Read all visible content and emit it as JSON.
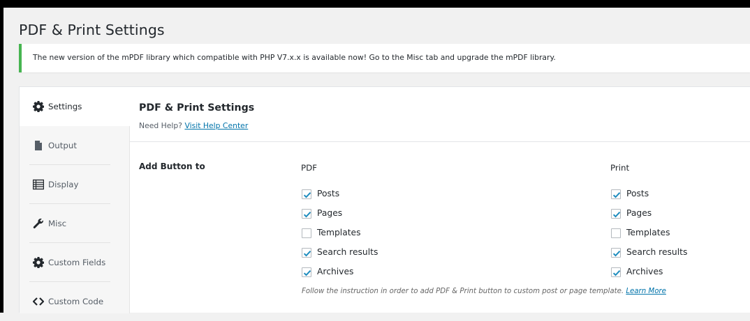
{
  "page": {
    "title": "PDF & Print Settings"
  },
  "notice": {
    "text": "The new version of the mPDF library which compatible with PHP V7.x.x is available now! Go to the Misc tab and upgrade the mPDF library.",
    "accent": "#46b450"
  },
  "sidebar": {
    "tabs": [
      {
        "label": "Settings",
        "icon": "gear-icon",
        "active": true
      },
      {
        "label": "Output",
        "icon": "document-icon",
        "active": false
      },
      {
        "label": "Display",
        "icon": "list-icon",
        "active": false
      },
      {
        "label": "Misc",
        "icon": "wrench-icon",
        "active": false
      },
      {
        "label": "Custom Fields",
        "icon": "gear-icon",
        "active": false
      },
      {
        "label": "Custom Code",
        "icon": "code-icon",
        "active": false
      }
    ]
  },
  "main": {
    "title": "PDF & Print Settings",
    "help_prefix": "Need Help?",
    "help_link": "Visit Help Center",
    "row_label": "Add Button to",
    "pdf": {
      "heading": "PDF",
      "options": [
        {
          "label": "Posts",
          "checked": true
        },
        {
          "label": "Pages",
          "checked": true
        },
        {
          "label": "Templates",
          "checked": false
        },
        {
          "label": "Search results",
          "checked": true
        },
        {
          "label": "Archives",
          "checked": true
        }
      ]
    },
    "print": {
      "heading": "Print",
      "options": [
        {
          "label": "Posts",
          "checked": true
        },
        {
          "label": "Pages",
          "checked": true
        },
        {
          "label": "Templates",
          "checked": false
        },
        {
          "label": "Search results",
          "checked": true
        },
        {
          "label": "Archives",
          "checked": true
        }
      ]
    },
    "note_text": "Follow the instruction in order to add PDF & Print button to custom post or page template.",
    "note_link": "Learn More"
  },
  "colors": {
    "link": "#0073aa",
    "check": "#1e8cbe"
  }
}
